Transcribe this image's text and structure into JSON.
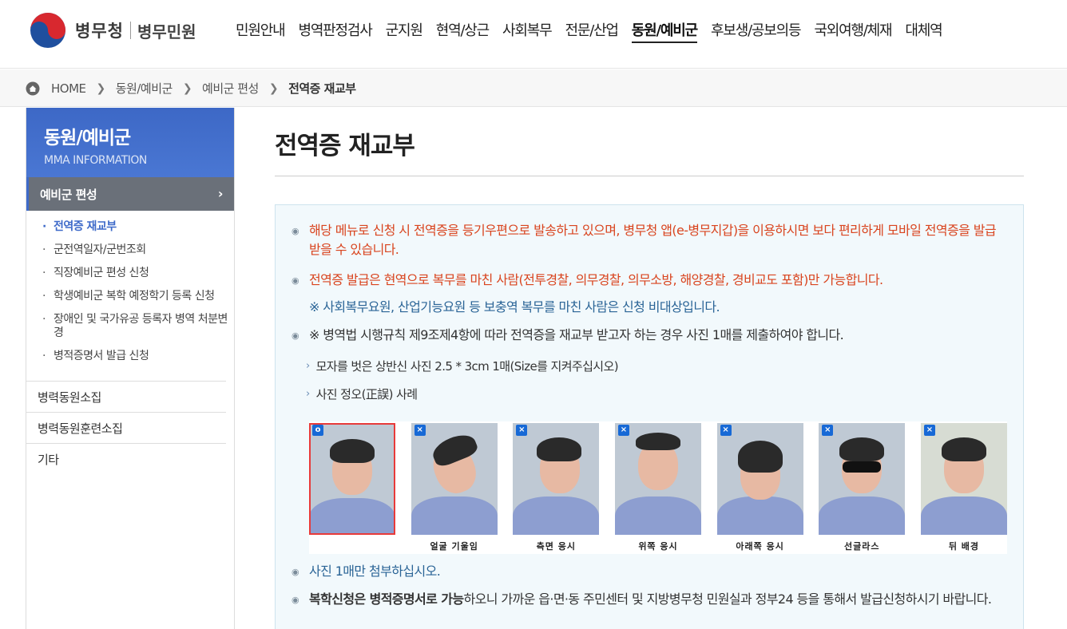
{
  "header": {
    "logo_text": "병무청",
    "logo_sub": "병무민원",
    "nav": [
      "민원안내",
      "병역판정검사",
      "군지원",
      "현역/상근",
      "사회복무",
      "전문/산업",
      "동원/예비군",
      "후보생/공보의등",
      "국외여행/체재",
      "대체역"
    ],
    "active_nav": "동원/예비군"
  },
  "breadcrumb": {
    "home": "HOME",
    "items": [
      "동원/예비군",
      "예비군 편성"
    ],
    "current": "전역증 재교부"
  },
  "sidebar": {
    "title": "동원/예비군",
    "subtitle": "MMA INFORMATION",
    "active_section": "예비군 편성",
    "subitems": [
      "전역증 재교부",
      "군전역일자/군번조회",
      "직장예비군 편성 신청",
      "학생예비군 복학 예정학기 등록 신청",
      "장애인 및 국가유공 등록자 병역 처분변경",
      "병적증명서 발급 신청"
    ],
    "menu": [
      "병력동원소집",
      "병력동원훈련소집",
      "기타"
    ]
  },
  "main": {
    "title": "전역증 재교부",
    "notices": [
      "해당 메뉴로 신청 시 전역증을 등기우편으로 발송하고 있으며, 병무청 앱(e-병무지갑)을 이용하시면 보다 편리하게 모바일 전역증을 발급 받을 수 있습니다.",
      "전역증 발급은 현역으로 복무를 마친 사람(전투경찰, 의무경찰, 의무소방, 해양경찰, 경비교도 포함)만 가능합니다.",
      "※ 사회복무요원, 산업기능요원 등 보충역 복무를 마친 사람은 신청 비대상입니다.",
      "※ 병역법 시행규칙 제9조제4항에 따라 전역증을 재교부 받고자 하는 경우 사진 1매를 제출하여야 합니다."
    ],
    "sub_notes": [
      "모자를 벗은 상반신 사진 2.5 * 3cm 1매(Size를 지켜주십시오)",
      "사진 정오(正誤) 사례"
    ],
    "photos": [
      {
        "mark": "o",
        "caption": ""
      },
      {
        "mark": "×",
        "caption": "얼굴 기울임"
      },
      {
        "mark": "×",
        "caption": "측면 응시"
      },
      {
        "mark": "×",
        "caption": "위쪽 응시"
      },
      {
        "mark": "×",
        "caption": "아래쪽 응시"
      },
      {
        "mark": "×",
        "caption": "선글라스"
      },
      {
        "mark": "×",
        "caption": "뒤 배경"
      }
    ],
    "attach_note": "사진 1매만 첨부하십시오.",
    "final_bold": "복학신청은 병적증명서로 가능",
    "final_rest": "하오니 가까운 읍·면·동 주민센터 및 지방병무청 민원실과 정부24 등을 통해서 발급신청하시기 바랍니다."
  },
  "colors": {
    "accent": "#3e6ac9",
    "notice_red": "#d9441e",
    "notice_blue": "#2a6496",
    "box_bg": "#f2f9fc"
  }
}
